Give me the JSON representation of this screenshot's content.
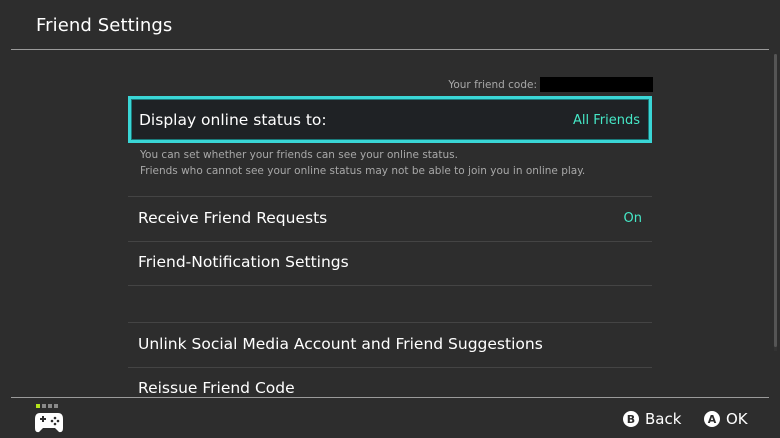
{
  "header": {
    "title": "Friend Settings"
  },
  "friend_code": {
    "label": "Your friend code:",
    "value": ""
  },
  "selected_row": {
    "label": "Display online status to:",
    "value": "All Friends"
  },
  "description": {
    "line1": "You can set whether your friends can see your online status.",
    "line2": "Friends who cannot see your online status may not be able to join you in online play."
  },
  "rows": [
    {
      "label": "Receive Friend Requests",
      "value": "On"
    },
    {
      "label": "Friend-Notification Settings",
      "value": ""
    },
    {
      "label": "Unlink Social Media Account and Friend Suggestions",
      "value": ""
    },
    {
      "label": "Reissue Friend Code",
      "value": ""
    }
  ],
  "footer": {
    "back": {
      "glyph": "B",
      "label": "Back"
    },
    "ok": {
      "glyph": "A",
      "label": "OK"
    },
    "controller_icon": "gamepad-icon"
  },
  "colors": {
    "background": "#2d2d2d",
    "selection_border": "#3ad6d6",
    "value_text": "#45e8c7",
    "player_indicator": "#b4e31b"
  }
}
